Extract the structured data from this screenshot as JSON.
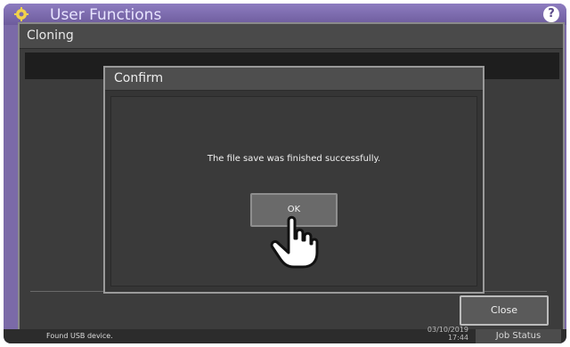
{
  "app": {
    "title": "User Functions",
    "help_label": "?"
  },
  "panel": {
    "title": "Cloning",
    "close_label": "Close"
  },
  "dialog": {
    "title": "Confirm",
    "message": "The file save was finished successfully.",
    "ok_label": "OK"
  },
  "status": {
    "message": "Found USB device.",
    "date": "03/10/2019",
    "time": "17:44",
    "job_status_label": "Job Status"
  },
  "colors": {
    "topbar": "#7b6aa8",
    "panel_bg": "#3c3c3c",
    "dialog_bg": "#353535"
  },
  "icons": [
    "gear-icon",
    "help-icon",
    "pointer-hand-icon"
  ]
}
